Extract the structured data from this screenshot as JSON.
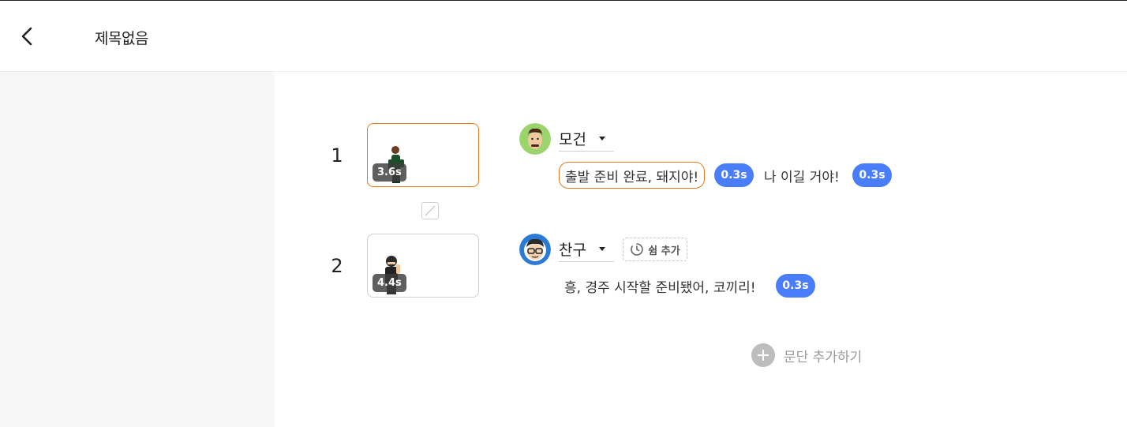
{
  "header": {
    "title": "제목없음"
  },
  "paragraphs": [
    {
      "number": "1",
      "duration": "3.6s",
      "speaker": "모건",
      "phrases": [
        {
          "text": "출발 준비 완료, 돼지야!",
          "pause": "0.3s"
        },
        {
          "text": "나 이길 거야!",
          "pause": "0.3s"
        }
      ]
    },
    {
      "number": "2",
      "duration": "4.4s",
      "speaker": "찬구",
      "rest_button_label": "쉼 추가",
      "phrases": [
        {
          "text": "흥, 경주 시작할 준비됐어, 코끼리!",
          "pause": "0.3s"
        }
      ]
    }
  ],
  "add_paragraph_label": "문단 추가하기",
  "icons": {
    "back": "chevron-left-icon",
    "dropdown": "caret-down-icon",
    "rest": "timer-icon",
    "add": "plus-circle-icon",
    "transition": "transition-slash-icon"
  },
  "colors": {
    "accent_orange": "#e87a1d",
    "pause_blue": "#4a7dfa",
    "left_panel_bg": "#f7f7f7"
  }
}
